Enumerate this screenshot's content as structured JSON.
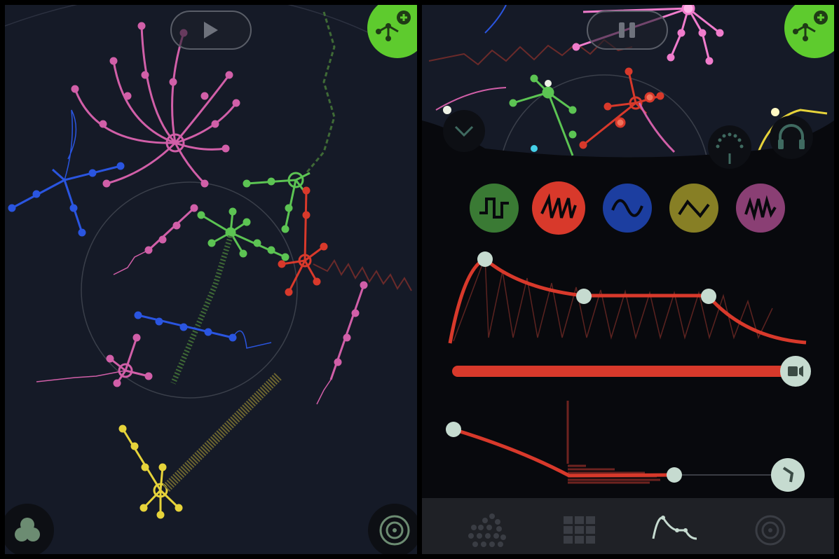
{
  "left": {
    "play_button": {
      "icon": "play-icon"
    },
    "add_creature_button": {
      "icon": "add-creature-icon"
    },
    "palette_button": {
      "icon": "circles-icon"
    },
    "target_button": {
      "icon": "target-icon"
    }
  },
  "right": {
    "pause_button": {
      "icon": "pause-icon"
    },
    "add_creature_button": {
      "icon": "add-creature-icon"
    },
    "collapse_button": {
      "icon": "chevron-down-icon"
    },
    "knob_button": {
      "icon": "knob-icon"
    },
    "headphones_button": {
      "icon": "headphones-icon"
    },
    "waveforms": [
      {
        "name": "square",
        "icon": "square-wave-icon",
        "color": "#3a7a34"
      },
      {
        "name": "sawtooth",
        "icon": "saw-wave-icon",
        "color": "#d8392b",
        "selected": true
      },
      {
        "name": "sine",
        "icon": "sine-wave-icon",
        "color": "#1c3ea0"
      },
      {
        "name": "triangle",
        "icon": "triangle-wave-icon",
        "color": "#877f25"
      },
      {
        "name": "noise",
        "icon": "noise-wave-icon",
        "color": "#8a3f74"
      }
    ],
    "tabs": [
      {
        "name": "creatures",
        "icon": "dots-icon",
        "active": false
      },
      {
        "name": "grid",
        "icon": "grid-icon",
        "active": false
      },
      {
        "name": "envelope",
        "icon": "envelope-icon",
        "active": true
      },
      {
        "name": "target",
        "icon": "target-icon",
        "active": false
      }
    ],
    "colors": {
      "accent": "#d8392b",
      "handle": "#c6dbd0",
      "fab": "#5ecb2e"
    }
  }
}
